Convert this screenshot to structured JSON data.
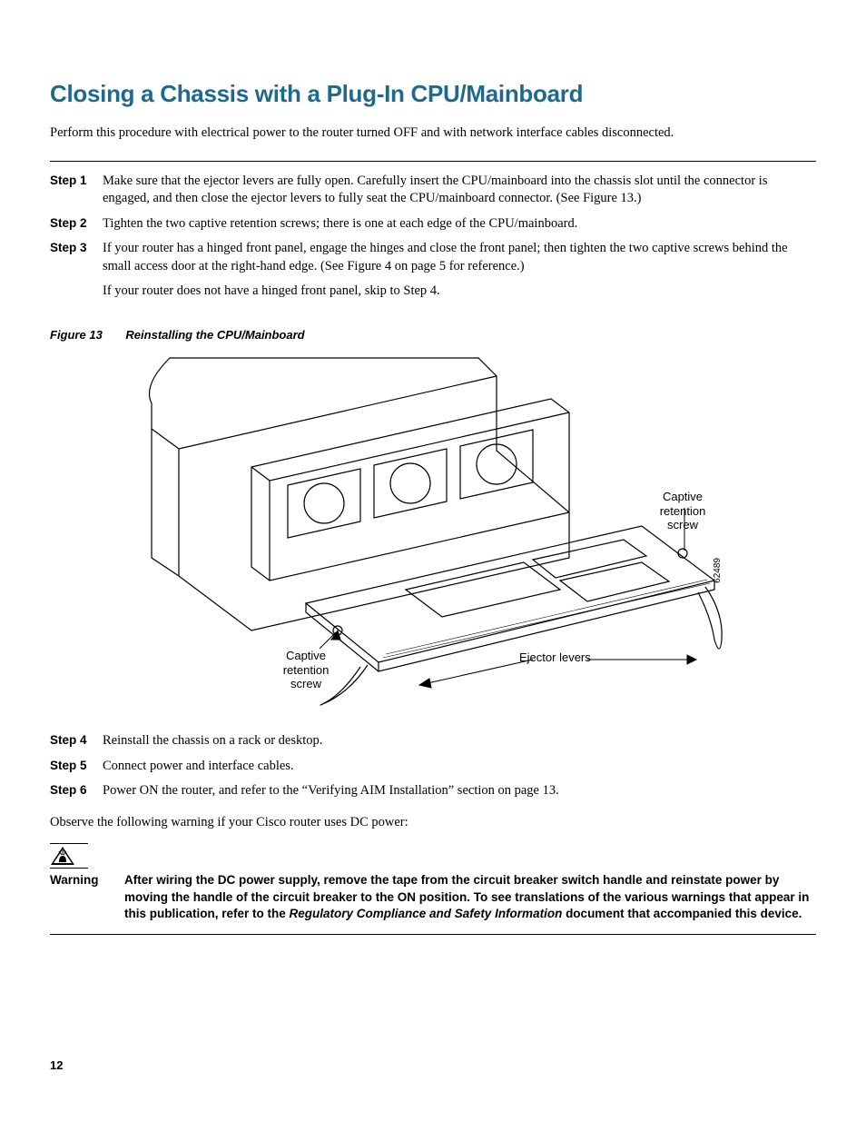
{
  "title": "Closing a Chassis with a Plug-In CPU/Mainboard",
  "intro": "Perform this procedure with electrical power to the router turned OFF and with network interface cables disconnected.",
  "steps_a": [
    {
      "label": "Step 1",
      "text": "Make sure that the ejector levers are fully open. Carefully insert the CPU/mainboard into the chassis slot until the connector is engaged, and then close the ejector levers to fully seat the CPU/mainboard connector. (See Figure 13.)"
    },
    {
      "label": "Step 2",
      "text": "Tighten the two captive retention screws; there is one at each edge of the CPU/mainboard."
    },
    {
      "label": "Step 3",
      "text": "If your router has a hinged front panel, engage the hinges and close the front panel; then tighten the two captive screws behind the small access door at the right-hand edge. (See Figure 4 on page 5 for reference.)",
      "text2": "If your router does not have a hinged front panel, skip to Step 4."
    }
  ],
  "figure": {
    "num": "Figure 13",
    "title": "Reinstalling the CPU/Mainboard",
    "callouts": {
      "left_screw": "Captive\nretention\nscrew",
      "right_screw": "Captive\nretention\nscrew",
      "ejector": "Ejector levers"
    },
    "ident": "62489"
  },
  "steps_b": [
    {
      "label": "Step 4",
      "text": "Reinstall the chassis on a rack or desktop."
    },
    {
      "label": "Step 5",
      "text": "Connect power and interface cables."
    },
    {
      "label": "Step 6",
      "text": "Power ON the router, and refer to the “Verifying AIM Installation” section on page 13."
    }
  ],
  "observe": "Observe the following warning if your Cisco router uses DC power:",
  "warning": {
    "label": "Warning",
    "pre": "After wiring the DC power supply, remove the tape from the circuit breaker switch handle and reinstate power by moving the handle of the circuit breaker to the ON position. To see translations of the various warnings that appear in this publication, refer to the ",
    "italic": "Regulatory Compliance and Safety Information",
    "post": " document that accompanied this device."
  },
  "page_num": "12"
}
